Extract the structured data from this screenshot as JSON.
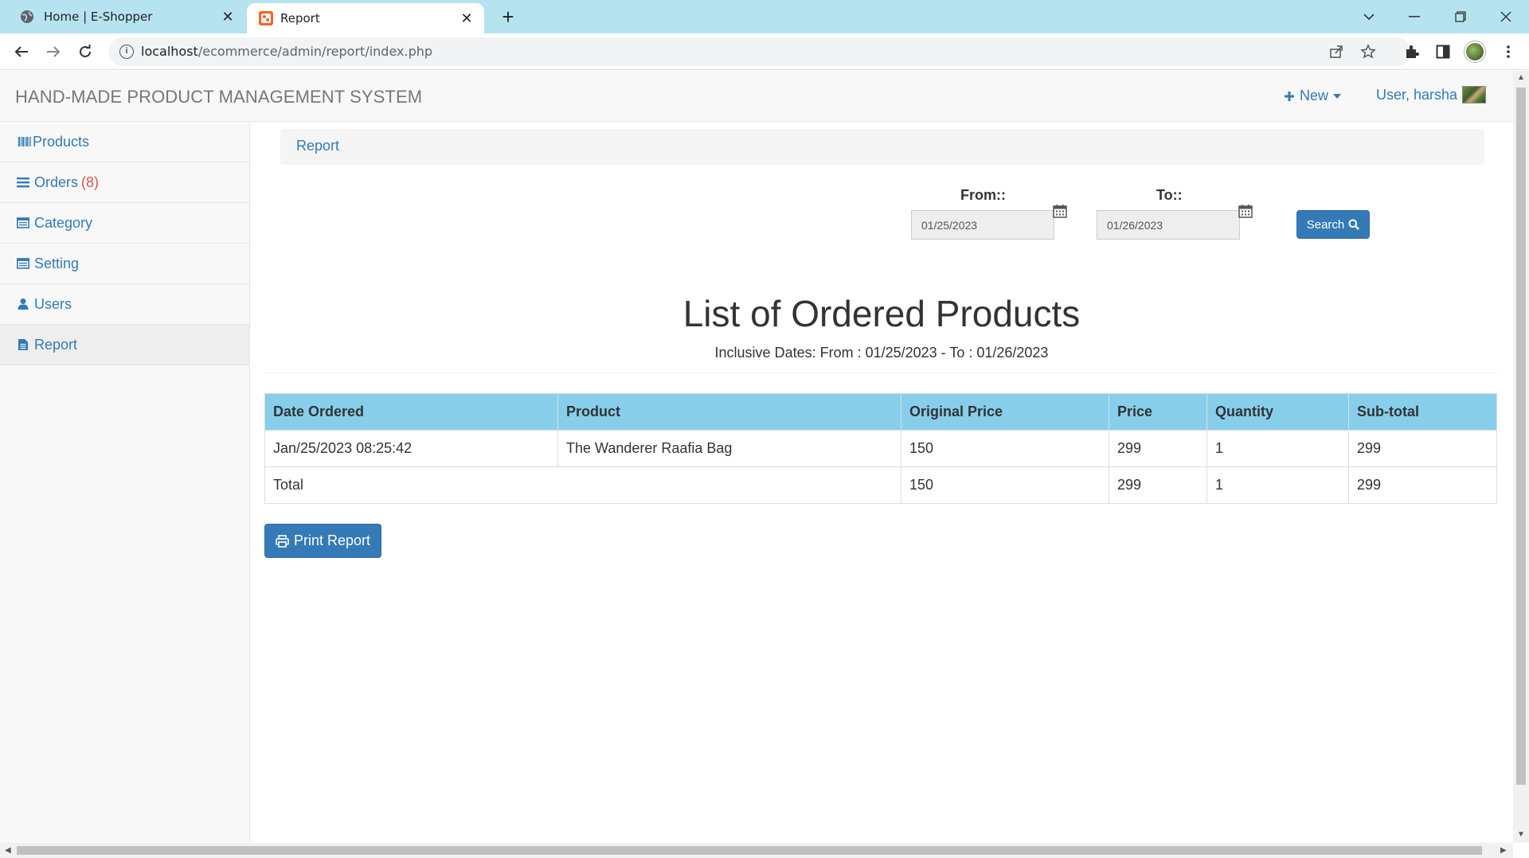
{
  "browser": {
    "tabs": [
      {
        "title": "Home | E-Shopper",
        "icon": "globe-icon",
        "active": false
      },
      {
        "title": "Report",
        "icon": "site-favicon",
        "active": true
      }
    ],
    "url_host": "localhost",
    "url_path": "/ecommerce/admin/report/index.php"
  },
  "header": {
    "brand": "HAND-MADE PRODUCT MANAGEMENT SYSTEM",
    "new_label": "New",
    "user_label": "User, harsha"
  },
  "sidebar": {
    "items": [
      {
        "label": "Products",
        "icon": "barcode-icon"
      },
      {
        "label": "Orders",
        "count": "(8)",
        "icon": "list-icon"
      },
      {
        "label": "Category",
        "icon": "window-list-icon"
      },
      {
        "label": "Setting",
        "icon": "window-list-icon"
      },
      {
        "label": "Users",
        "icon": "user-icon"
      },
      {
        "label": "Report",
        "icon": "file-icon",
        "active": true
      }
    ]
  },
  "breadcrumb": {
    "label": "Report"
  },
  "filter": {
    "from_label": "From::",
    "from_value": "01/25/2023",
    "to_label": "To::",
    "to_value": "01/26/2023",
    "search_label": "Search"
  },
  "report": {
    "title": "List of Ordered Products",
    "subtitle": "Inclusive Dates: From : 01/25/2023 - To : 01/26/2023",
    "columns": [
      "Date Ordered",
      "Product",
      "Original Price",
      "Price",
      "Quantity",
      "Sub-total"
    ],
    "rows": [
      [
        "Jan/25/2023 08:25:42",
        "The Wanderer Raafia Bag",
        "150",
        "299",
        "1",
        "299"
      ]
    ],
    "total": {
      "label": "Total",
      "original_price": "150",
      "price": "299",
      "quantity": "1",
      "subtotal": "299"
    },
    "print_label": "Print Report"
  },
  "colors": {
    "link": "#337ab7",
    "table_header": "#87ceeb",
    "tabbar": "#b6e3f0",
    "badge": "#d9534f"
  }
}
